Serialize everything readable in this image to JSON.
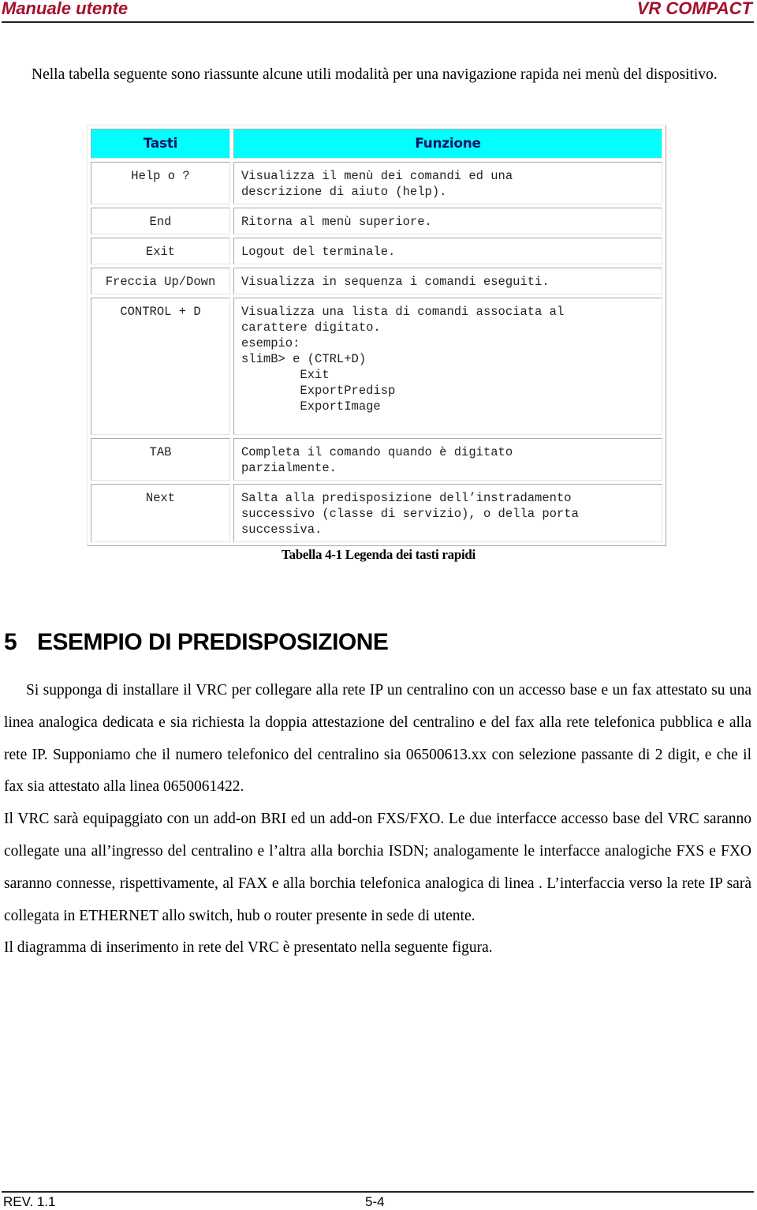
{
  "header": {
    "left": "Manuale utente",
    "right": "VR COMPACT",
    "accent_color": "#a50f2d"
  },
  "intro": "Nella tabella seguente sono riassunte alcune utili modalità per una navigazione rapida nei menù del dispositivo.",
  "table": {
    "header_color": "#00ffff",
    "columns": [
      "Tasti",
      "Funzione"
    ],
    "rows": [
      {
        "key": "Help o ?",
        "function": "Visualizza il menù dei comandi ed una\ndescrizione di aiuto (help)."
      },
      {
        "key": "End",
        "function": "Ritorna al menù superiore."
      },
      {
        "key": "Exit",
        "function": "Logout del terminale."
      },
      {
        "key": "Freccia Up/Down",
        "function": "Visualizza in sequenza i comandi eseguiti."
      },
      {
        "key": "CONTROL + D",
        "function": "Visualizza una lista di comandi associata al\ncarattere digitato.\nesempio:\nslimB> e (CTRL+D)\n        Exit\n        ExportPredisp\n        ExportImage\n "
      },
      {
        "key": "TAB",
        "function": "Completa il comando quando è digitato\nparzialmente."
      },
      {
        "key": "Next",
        "function": "Salta alla predisposizione dell’instradamento\nsuccessivo (classe di servizio), o della porta\nsuccessiva."
      }
    ],
    "caption": "Tabella 4-1 Legenda dei tasti rapidi"
  },
  "section": {
    "number": "5",
    "title": "ESEMPIO DI PREDISPOSIZIONE"
  },
  "paragraphs": [
    "Si supponga di installare il VRC  per collegare alla rete IP un centralino con un accesso base e un fax attestato su una linea analogica dedicata e sia richiesta la doppia attestazione del centralino e del fax alla rete telefonica pubblica e alla rete IP. Supponiamo che il numero telefonico del centralino sia 06500613.xx con selezione passante di 2 digit, e che il  fax sia attestato alla linea 0650061422.",
    "Il VRC sarà equipaggiato con un add-on BRI ed un add-on FXS/FXO. Le due interfacce accesso base del VRC saranno collegate una all’ingresso del centralino e l’altra alla borchia ISDN; analogamente le interfacce analogiche FXS e FXO saranno connesse, rispettivamente, al FAX e alla borchia telefonica analogica di linea . L’interfaccia verso la rete IP sarà collegata in ETHERNET allo switch, hub o router presente in sede di utente.",
    "Il diagramma di inserimento in rete del VRC è presentato nella seguente figura."
  ],
  "footer": {
    "revision": "REV. 1.1",
    "page": "5-4"
  }
}
